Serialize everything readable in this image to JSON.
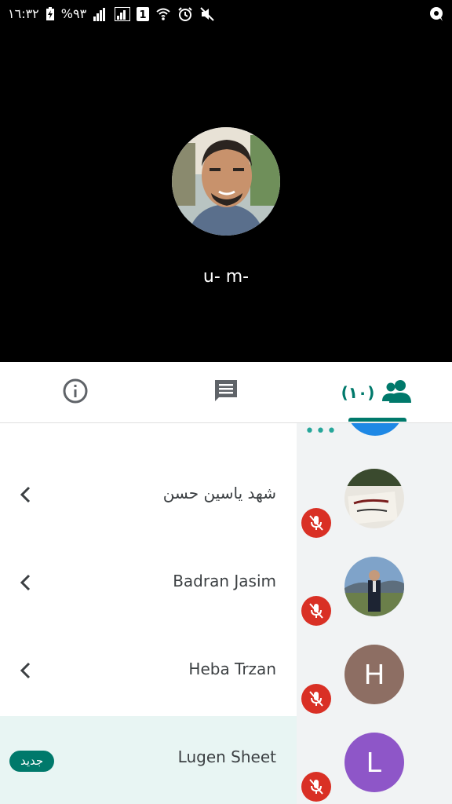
{
  "status_bar": {
    "time": "١٦:٣٢",
    "battery": "%٩٣",
    "sim_label": "1"
  },
  "presenter": {
    "name": "u- m-"
  },
  "tabs": {
    "info_icon": "info-icon",
    "chat_icon": "chat-icon",
    "people_icon": "people-icon",
    "people_count": "(١٠)"
  },
  "participants": [
    {
      "name": "شهد ياسين حسن",
      "avatar_type": "photo",
      "muted": true
    },
    {
      "name": "Badran Jasim",
      "avatar_type": "photo",
      "muted": true
    },
    {
      "name": "Heba Trzan",
      "avatar_type": "letter",
      "initial": "H",
      "avatar_color": "#8d6e63",
      "muted": true
    },
    {
      "name": "Lugen Sheet",
      "avatar_type": "letter",
      "initial": "L",
      "avatar_color": "#8e56c8",
      "muted": true,
      "badge": "جديد"
    }
  ],
  "colors": {
    "accent": "#00796b",
    "mute_red": "#d93025",
    "highlight_row": "#e8f5f3"
  }
}
